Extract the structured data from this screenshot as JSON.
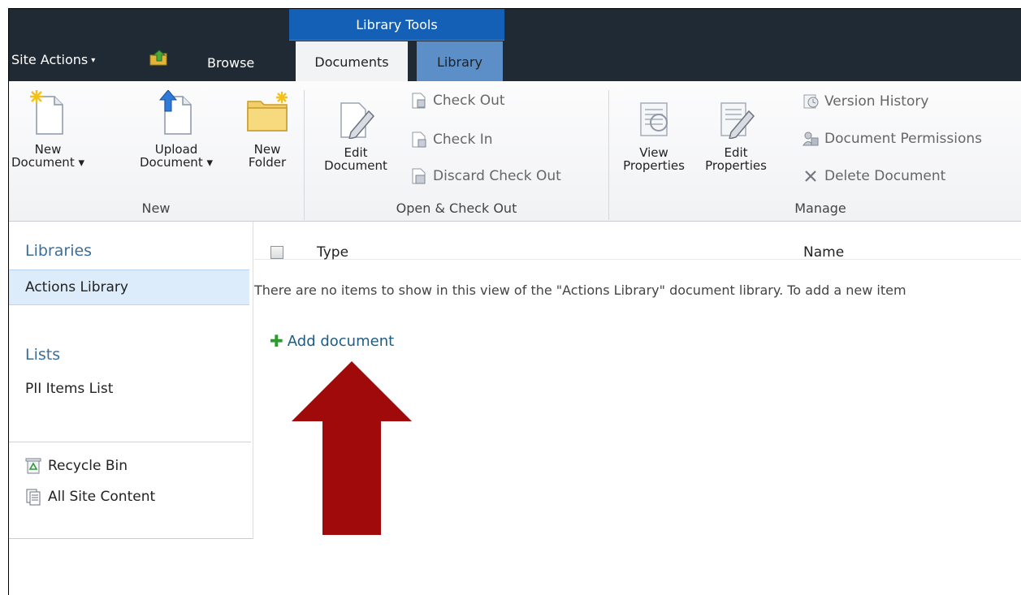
{
  "top_bar": {
    "site_actions_label": "Site Actions",
    "site_actions_caret": "▾",
    "browse_label": "Browse",
    "context_group_title": "Library Tools",
    "tab_documents": "Documents",
    "tab_library": "Library"
  },
  "ribbon": {
    "groups": {
      "new": {
        "label": "New",
        "new_document_l1": "New",
        "new_document_l2": "Document ▾",
        "upload_document_l1": "Upload",
        "upload_document_l2": "Document ▾",
        "new_folder_l1": "New",
        "new_folder_l2": "Folder"
      },
      "open_checkout": {
        "label": "Open & Check Out",
        "edit_document_l1": "Edit",
        "edit_document_l2": "Document",
        "check_out": "Check Out",
        "check_in": "Check In",
        "discard_check_out": "Discard Check Out"
      },
      "manage": {
        "label": "Manage",
        "view_properties_l1": "View",
        "view_properties_l2": "Properties",
        "edit_properties_l1": "Edit",
        "edit_properties_l2": "Properties",
        "version_history": "Version History",
        "document_permissions": "Document Permissions",
        "delete_document": "Delete Document"
      }
    }
  },
  "left_nav": {
    "libraries_heading": "Libraries",
    "actions_library": "Actions Library",
    "lists_heading": "Lists",
    "pii_items_list": "PII Items List",
    "recycle_bin": "Recycle Bin",
    "all_site_content": "All Site Content"
  },
  "main": {
    "column_type": "Type",
    "column_name": "Name",
    "empty_message": "There are no items to show in this view of the \"Actions Library\" document library. To add a new item",
    "add_document_label": "Add document"
  },
  "colors": {
    "top_bar": "#1f2a34",
    "context_tab": "#1560b7",
    "library_tab": "#5c8fc8",
    "selected_nav": "#dcecfa",
    "link": "#1b5d86",
    "annotation_arrow": "#a10a0a"
  }
}
